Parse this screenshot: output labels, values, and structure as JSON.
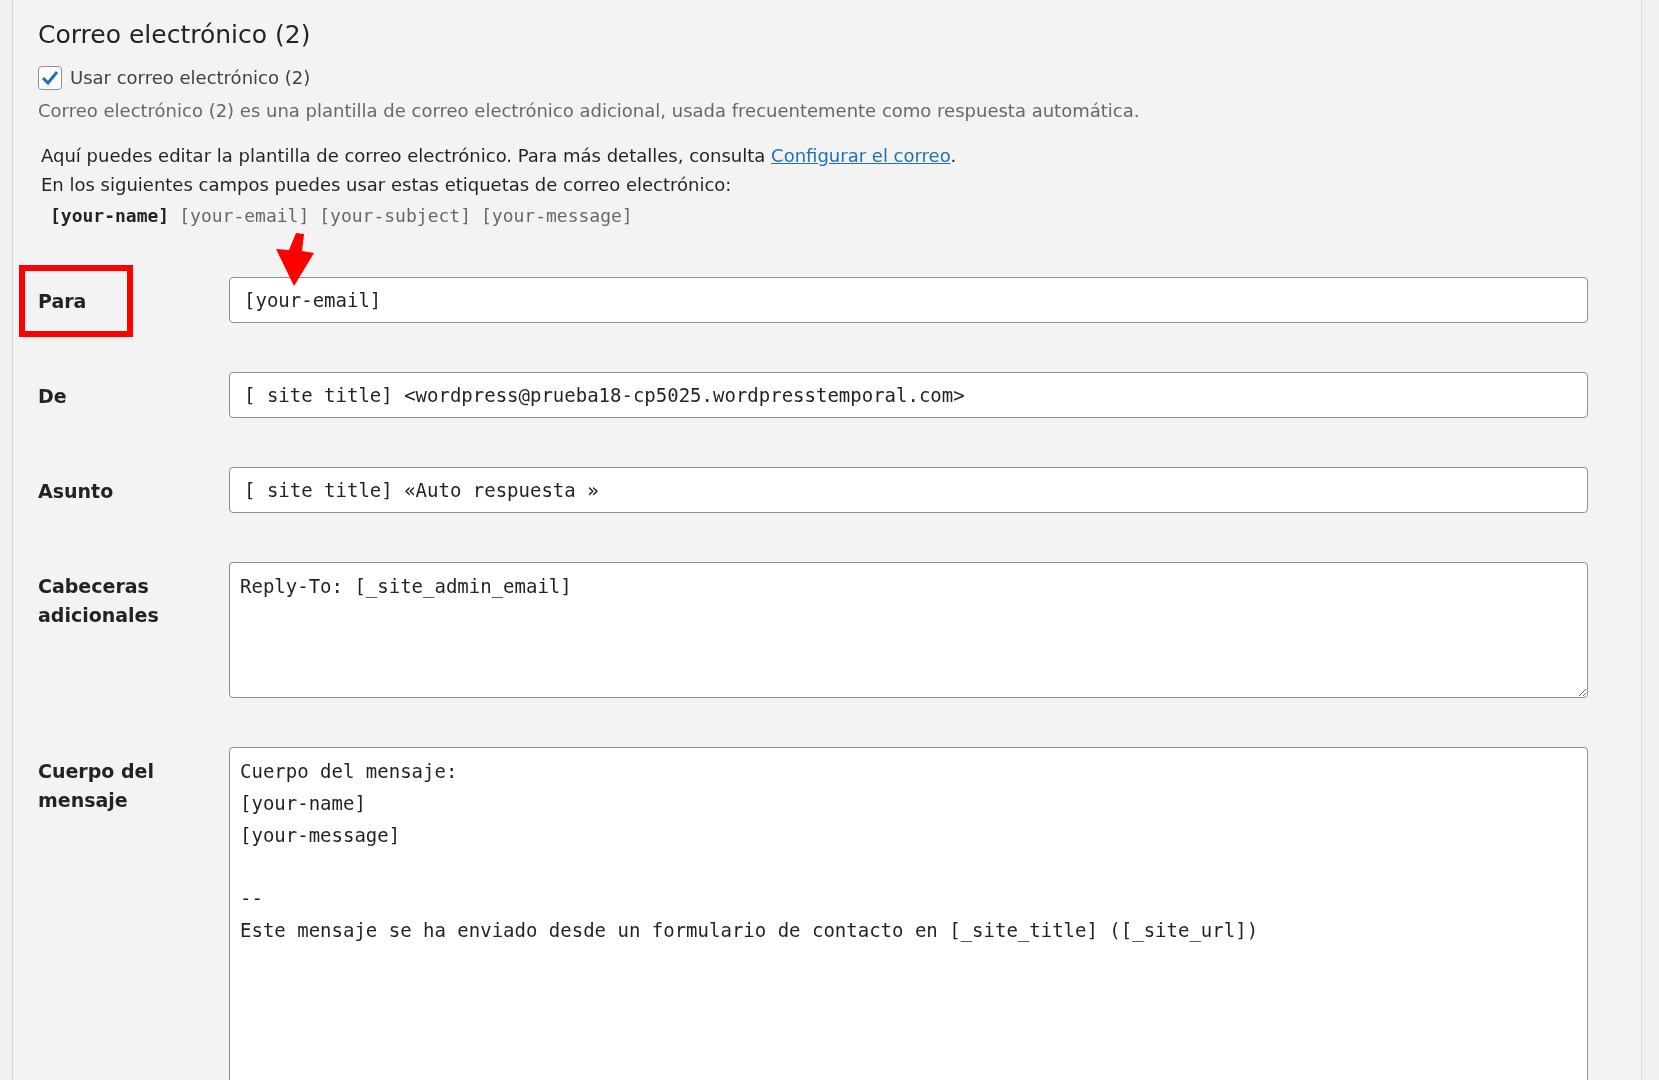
{
  "section": {
    "title": "Correo electrónico (2)",
    "use_checkbox": {
      "label": "Usar correo electrónico (2)",
      "checked": true
    },
    "description": "Correo electrónico (2) es una plantilla de correo electrónico adicional, usada frecuentemente como respuesta automática.",
    "help": {
      "text": "Aquí puedes editar la plantilla de correo electrónico. Para más detalles, consulta ",
      "link": "Configurar el correo",
      "end": "."
    },
    "tags_intro": "En los siguientes campos puedes usar estas etiquetas de correo electrónico:",
    "tags": [
      {
        "text": "[your-name]",
        "bold": true
      },
      {
        "text": "[your-email]",
        "bold": false
      },
      {
        "text": "[your-subject]",
        "bold": false
      },
      {
        "text": "[your-message]",
        "bold": false
      }
    ]
  },
  "fields": [
    {
      "label": "Para",
      "kind": "input",
      "value": "[your-email]",
      "highlighted": true,
      "arrow": true
    },
    {
      "label": "De",
      "kind": "input",
      "value": "[_site_title] <wordpress@prueba18-cp5025.wordpresstemporal.com>",
      "highlighted": false,
      "arrow": false
    },
    {
      "label": "Asunto",
      "kind": "input",
      "value": "[_site_title] «Auto respuesta »",
      "highlighted": false,
      "arrow": false
    },
    {
      "label": "Cabeceras adicionales",
      "kind": "textarea",
      "value": "Reply-To: [_site_admin_email]",
      "highlighted": false,
      "arrow": false
    },
    {
      "label": "Cuerpo del mensaje",
      "kind": "textarea-large",
      "value": "Cuerpo del mensaje:\n[your-name]\n[your-message]\n\n--\nEste mensaje se ha enviado desde un formulario de contacto en [_site_title] ([_site_url])",
      "highlighted": false,
      "arrow": false
    }
  ]
}
